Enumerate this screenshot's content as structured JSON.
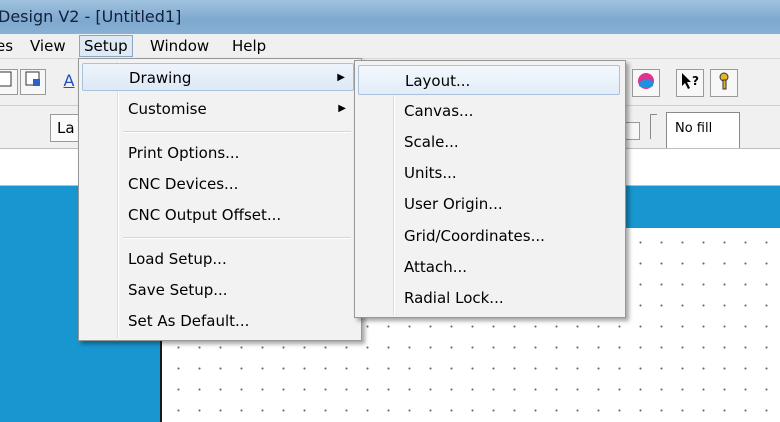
{
  "window": {
    "title": "Design V2 - [Untitled1]"
  },
  "menubar": {
    "items": [
      {
        "label": "es"
      },
      {
        "label": "View"
      },
      {
        "label": "Setup"
      },
      {
        "label": "Window"
      },
      {
        "label": "Help"
      }
    ]
  },
  "toolbar": {
    "la_label": "La",
    "fill_label": "No fill",
    "a_label": "A"
  },
  "setup_menu": {
    "items": [
      {
        "label": "Drawing",
        "submenu": true
      },
      {
        "label": "Customise",
        "submenu": true
      },
      {
        "label": "Print Options..."
      },
      {
        "label": "CNC Devices..."
      },
      {
        "label": "CNC Output Offset..."
      },
      {
        "label": "Load Setup..."
      },
      {
        "label": "Save Setup..."
      },
      {
        "label": "Set As Default..."
      }
    ]
  },
  "drawing_submenu": {
    "items": [
      {
        "label": "Layout..."
      },
      {
        "label": "Canvas..."
      },
      {
        "label": "Scale..."
      },
      {
        "label": "Units..."
      },
      {
        "label": "User Origin..."
      },
      {
        "label": "Grid/Coordinates..."
      },
      {
        "label": "Attach..."
      },
      {
        "label": "Radial Lock..."
      }
    ]
  },
  "colors": {
    "desktop_blue": "#1796cf",
    "menu_bg": "#f2f2f2",
    "highlight_border": "#a9c2dd"
  },
  "icons": [
    "file-icon",
    "image-icon",
    "color-globe-icon",
    "help-pointer-icon",
    "key-icon",
    "submenu-arrow-icon"
  ]
}
